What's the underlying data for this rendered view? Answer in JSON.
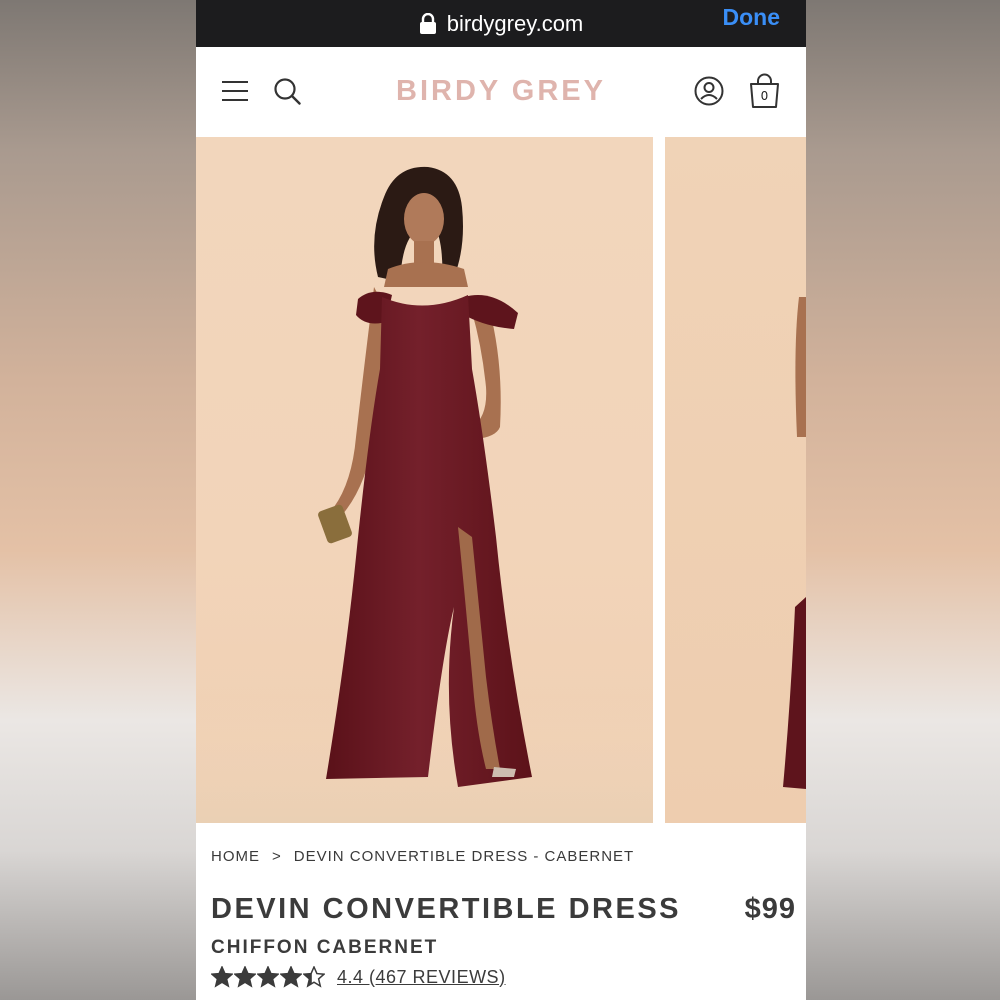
{
  "browser": {
    "url": "birdygrey.com",
    "done_label": "Done"
  },
  "header": {
    "logo": "BIRDY GREY",
    "cart_count": "0"
  },
  "breadcrumb": {
    "home": "HOME",
    "separator": ">",
    "current": "DEVIN CONVERTIBLE DRESS - CABERNET"
  },
  "product": {
    "title": "DEVIN CONVERTIBLE DRESS",
    "price": "$99",
    "color": "CHIFFON CABERNET",
    "rating_value": 4.4,
    "rating_max": 5,
    "reviews_label": "4.4 (467 REVIEWS)"
  },
  "colors": {
    "dress": "#6e1a24",
    "backdrop": "#f2d5ba",
    "logo": "#dfb4ad",
    "done": "#3a8ef6"
  }
}
